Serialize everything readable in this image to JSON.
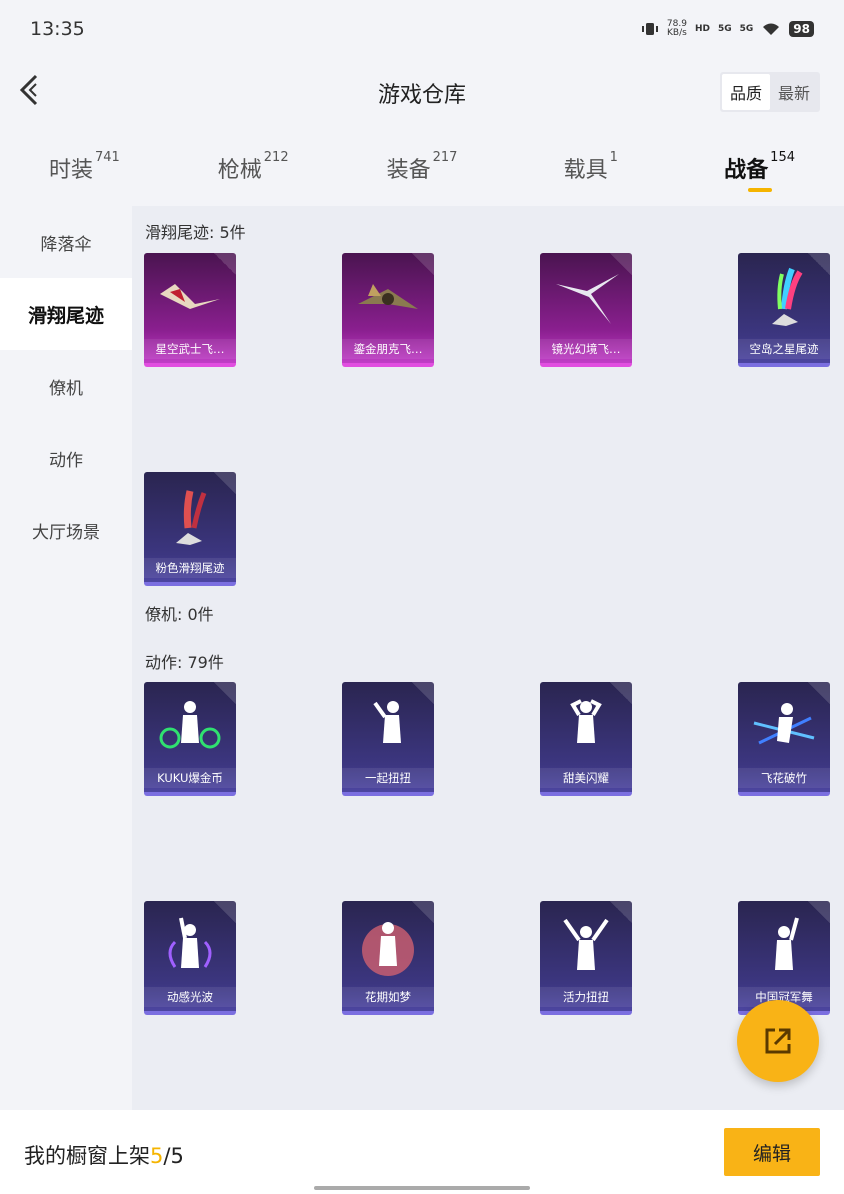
{
  "status_bar": {
    "time": "13:35",
    "net_speed": "78.9",
    "net_unit": "KB/s",
    "hd": "HD",
    "sig1": "5G",
    "sig2": "5G",
    "battery": "98"
  },
  "header": {
    "title": "游戏仓库",
    "sort_options": [
      "品质",
      "最新"
    ]
  },
  "tabs": [
    {
      "label": "时装",
      "count": "741"
    },
    {
      "label": "枪械",
      "count": "212"
    },
    {
      "label": "装备",
      "count": "217"
    },
    {
      "label": "载具",
      "count": "1"
    },
    {
      "label": "战备",
      "count": "154"
    }
  ],
  "sidebar": {
    "items": [
      "降落伞",
      "滑翔尾迹",
      "僚机",
      "动作",
      "大厅场景"
    ]
  },
  "sections": {
    "glide": {
      "title": "滑翔尾迹: 5件"
    },
    "wingman": {
      "title": "僚机: 0件"
    },
    "action": {
      "title": "动作: 79件"
    }
  },
  "glide_items": [
    "星空武士飞…",
    "鎏金朋克飞…",
    "镜光幻境飞…",
    "空岛之星尾迹",
    "粉色滑翔尾迹"
  ],
  "action_items": [
    "KUKU爆金币",
    "一起扭扭",
    "甜美闪耀",
    "飞花破竹",
    "动感光波",
    "花期如梦",
    "活力扭扭",
    "中国冠军舞"
  ],
  "bottom_bar": {
    "showcase_label": "我的橱窗上架",
    "showcase_count": "5",
    "showcase_total": "/5",
    "edit_label": "编辑"
  },
  "colors": {
    "accent": "#f9b316",
    "rare_purple": "#c03ec6",
    "epic_blue": "#4c45a0"
  }
}
